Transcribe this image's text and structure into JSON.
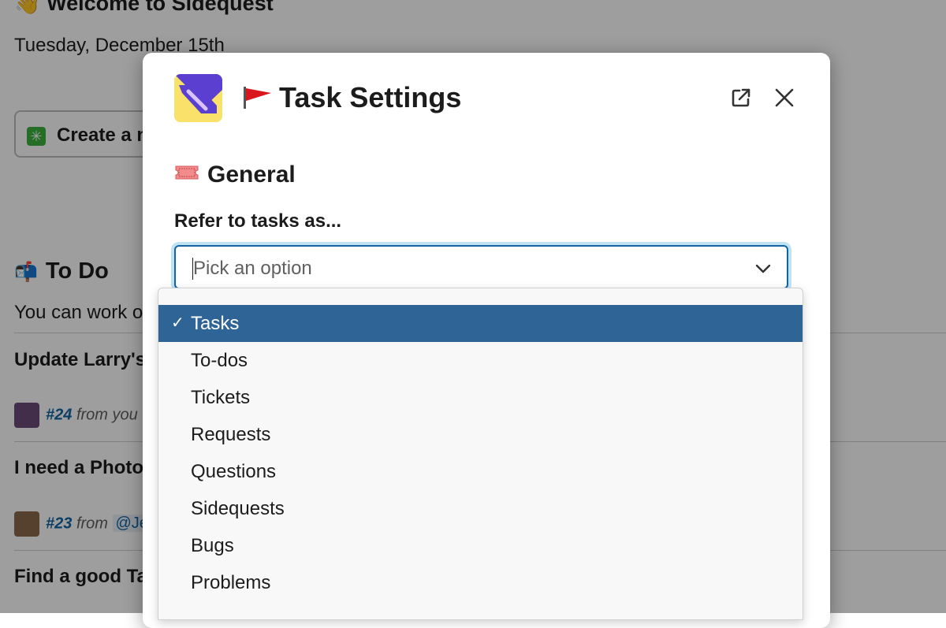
{
  "background": {
    "welcome": "Welcome to Sidequest",
    "date": "Tuesday, December 15th",
    "create_button": "Create a n",
    "todo_heading": "To Do",
    "todo_desc": "You can work o",
    "tasks": [
      {
        "title": "Update Larry's",
        "number": "#24",
        "from": "from you"
      },
      {
        "title": "I need a Photo",
        "number": "#23",
        "from": "from",
        "mention": "@Je"
      },
      {
        "title": "Find a good Ta"
      }
    ]
  },
  "modal": {
    "title": "Task Settings",
    "section": "General",
    "field_label": "Refer to tasks as...",
    "placeholder": "Pick an option"
  },
  "dropdown": {
    "check_mark": "✓",
    "options": [
      {
        "label": "Tasks",
        "selected": true
      },
      {
        "label": "To-dos"
      },
      {
        "label": "Tickets"
      },
      {
        "label": "Requests"
      },
      {
        "label": "Questions"
      },
      {
        "label": "Sidequests"
      },
      {
        "label": "Bugs"
      },
      {
        "label": "Problems"
      }
    ]
  },
  "colors": {
    "selected_option": "#2f6497",
    "focus_border": "#1264a3",
    "logo_yellow": "#f9e16a",
    "logo_purple": "#5b3fd1"
  }
}
